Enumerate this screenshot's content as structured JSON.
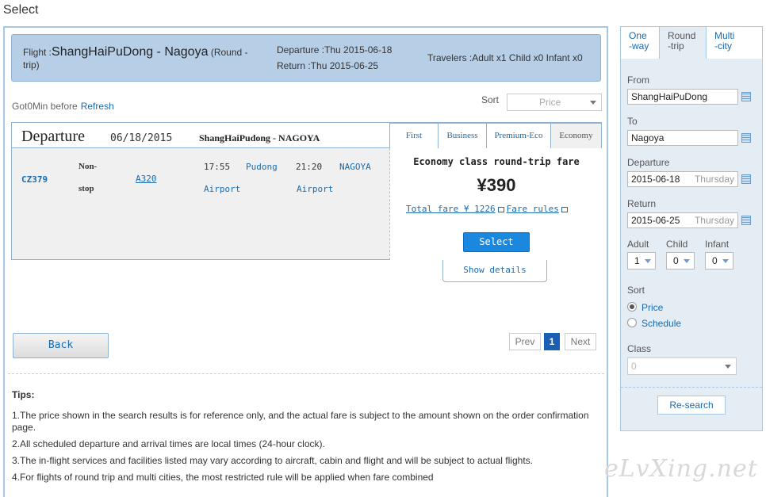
{
  "page": {
    "title": "Select"
  },
  "summary": {
    "flight_label": "Flight :",
    "route": "ShangHaiPuDong - Nagoya",
    "trip_type": "(Round -trip)",
    "departure": "Departure :Thu 2015-06-18",
    "return": "Return :Thu 2015-06-25",
    "travelers": "Travelers :Adult x1 Child x0 Infant x0"
  },
  "status": {
    "got_text": "Got0Min before",
    "refresh": "Refresh"
  },
  "sort": {
    "label": "Sort",
    "value": "Price"
  },
  "result": {
    "title": "Departure",
    "date": "06/18/2015",
    "route": "ShangHaiPudong - NAGOYA",
    "cabin_tabs": [
      "First",
      "Business",
      "Premium-Eco",
      "Economy"
    ],
    "flight": {
      "number": "CZ379",
      "stop_1": "Non-",
      "stop_2": "stop",
      "aircraft": "A320",
      "dep_time": "17:55",
      "dep_airport_1": "Pudong",
      "dep_airport_2": "Airport",
      "arr_time": "21:20",
      "arr_airport_1": "NAGOYA",
      "arr_airport_2": "Airport"
    },
    "fare": {
      "title": "Economy class round-trip fare",
      "price": "¥390",
      "total": "Total fare ¥ 1226",
      "rules": "Fare rules",
      "select": "Select"
    },
    "show_details": "Show details"
  },
  "nav": {
    "back": "Back",
    "prev": "Prev",
    "page": "1",
    "next": "Next"
  },
  "tips": {
    "title": "Tips:",
    "items": [
      "1.The price shown in the search results is for reference only, and the actual fare is subject to the amount shown on the order confirmation page.",
      "2.All scheduled departure and arrival times are local times (24-hour clock).",
      "3.The in-flight services and facilities listed may vary according to aircraft, cabin and flight and will be subject to actual flights.",
      "4.For flights of round trip and multi cities, the most restricted rule will be applied when fare combined"
    ]
  },
  "search": {
    "tabs": [
      {
        "line1": "One",
        "line2": "-way"
      },
      {
        "line1": "Round",
        "line2": "-trip"
      },
      {
        "line1": "Multi",
        "line2": "-city"
      }
    ],
    "from_label": "From",
    "from_value": "ShangHaiPuDong",
    "to_label": "To",
    "to_value": "Nagoya",
    "departure_label": "Departure",
    "departure_value": "2015-06-18",
    "departure_day": "Thursday",
    "return_label": "Return",
    "return_value": "2015-06-25",
    "return_day": "Thursday",
    "adult_label": "Adult",
    "adult_value": "1",
    "child_label": "Child",
    "child_value": "0",
    "infant_label": "Infant",
    "infant_value": "0",
    "sort_label": "Sort",
    "sort_price": "Price",
    "sort_schedule": "Schedule",
    "class_label": "Class",
    "class_value": "0",
    "research": "Re-search"
  },
  "watermark": "eLvXing.net",
  "colors": {
    "accent": "#1a6bb0",
    "summary_bg": "#b7cfe6",
    "select_button": "#1b88e0"
  }
}
